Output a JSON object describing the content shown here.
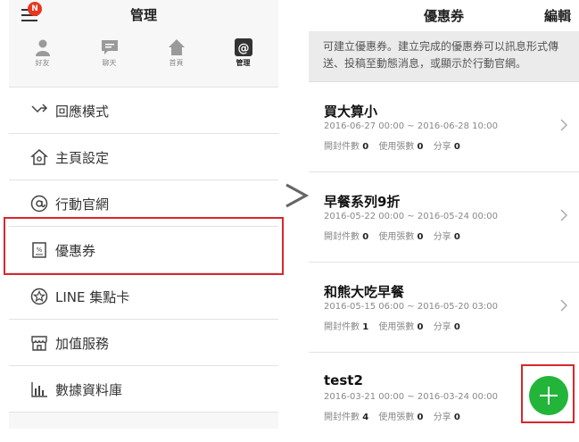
{
  "left_screen": {
    "title": "管理",
    "badge": "N",
    "tabs": [
      {
        "label": "好友",
        "icon": "person-icon"
      },
      {
        "label": "聊天",
        "icon": "chat-icon"
      },
      {
        "label": "首頁",
        "icon": "home-icon"
      },
      {
        "label": "管理",
        "icon": "at-icon",
        "active": true
      }
    ],
    "menu": [
      {
        "label": "回應模式",
        "icon": "reply-arrow-icon"
      },
      {
        "label": "主頁設定",
        "icon": "home-settings-icon"
      },
      {
        "label": "行動官網",
        "icon": "at-circle-icon"
      },
      {
        "label": "優惠券",
        "icon": "coupon-icon",
        "highlighted": true
      },
      {
        "label": "LINE 集點卡",
        "icon": "star-circle-icon"
      },
      {
        "label": "加值服務",
        "icon": "store-icon"
      },
      {
        "label": "數據資料庫",
        "icon": "bar-chart-icon"
      }
    ]
  },
  "right_screen": {
    "title": "優惠券",
    "edit_label": "編輯",
    "notice": "可建立優惠券。建立完成的優惠券可以訊息形式傳送、投稿至動態消息，或顯示於行動官網。",
    "stat_labels": {
      "opened": "開封件數",
      "used": "使用張數",
      "shared": "分享"
    },
    "coupons": [
      {
        "name": "買大算小",
        "period": "2016-06-27 00:00 ~ 2016-06-28 10:00",
        "opened": "0",
        "used": "0",
        "shared": "0"
      },
      {
        "name": "早餐系列9折",
        "period": "2016-05-22 00:00 ~ 2016-05-24 00:00",
        "opened": "0",
        "used": "0",
        "shared": "0"
      },
      {
        "name": "和熊大吃早餐",
        "period": "2016-05-15 06:00 ~ 2016-05-20 03:00",
        "opened": "1",
        "used": "0",
        "shared": "0"
      },
      {
        "name": "test2",
        "period": "2016-03-21 00:00 ~ 2016-03-24 00:00",
        "opened": "4",
        "used": "0",
        "shared": "0"
      }
    ],
    "fab_icon": "plus-icon"
  },
  "colors": {
    "accent_green": "#22b53a",
    "highlight_red": "#d9262c",
    "badge_red": "#e8361f"
  }
}
